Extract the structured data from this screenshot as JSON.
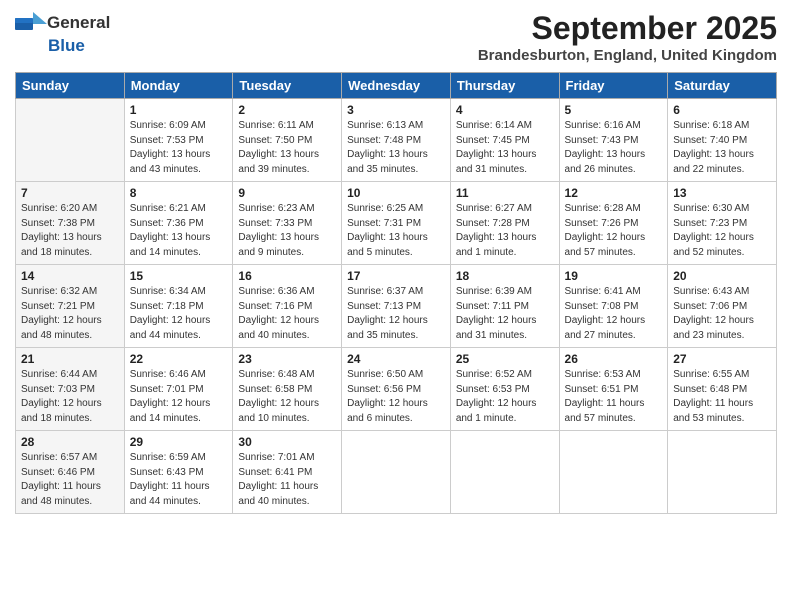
{
  "logo": {
    "general": "General",
    "blue": "Blue"
  },
  "title": "September 2025",
  "subtitle": "Brandesburton, England, United Kingdom",
  "days": [
    "Sunday",
    "Monday",
    "Tuesday",
    "Wednesday",
    "Thursday",
    "Friday",
    "Saturday"
  ],
  "weeks": [
    [
      {
        "day": "",
        "info": ""
      },
      {
        "day": "1",
        "info": "Sunrise: 6:09 AM\nSunset: 7:53 PM\nDaylight: 13 hours\nand 43 minutes."
      },
      {
        "day": "2",
        "info": "Sunrise: 6:11 AM\nSunset: 7:50 PM\nDaylight: 13 hours\nand 39 minutes."
      },
      {
        "day": "3",
        "info": "Sunrise: 6:13 AM\nSunset: 7:48 PM\nDaylight: 13 hours\nand 35 minutes."
      },
      {
        "day": "4",
        "info": "Sunrise: 6:14 AM\nSunset: 7:45 PM\nDaylight: 13 hours\nand 31 minutes."
      },
      {
        "day": "5",
        "info": "Sunrise: 6:16 AM\nSunset: 7:43 PM\nDaylight: 13 hours\nand 26 minutes."
      },
      {
        "day": "6",
        "info": "Sunrise: 6:18 AM\nSunset: 7:40 PM\nDaylight: 13 hours\nand 22 minutes."
      }
    ],
    [
      {
        "day": "7",
        "info": "Sunrise: 6:20 AM\nSunset: 7:38 PM\nDaylight: 13 hours\nand 18 minutes."
      },
      {
        "day": "8",
        "info": "Sunrise: 6:21 AM\nSunset: 7:36 PM\nDaylight: 13 hours\nand 14 minutes."
      },
      {
        "day": "9",
        "info": "Sunrise: 6:23 AM\nSunset: 7:33 PM\nDaylight: 13 hours\nand 9 minutes."
      },
      {
        "day": "10",
        "info": "Sunrise: 6:25 AM\nSunset: 7:31 PM\nDaylight: 13 hours\nand 5 minutes."
      },
      {
        "day": "11",
        "info": "Sunrise: 6:27 AM\nSunset: 7:28 PM\nDaylight: 13 hours\nand 1 minute."
      },
      {
        "day": "12",
        "info": "Sunrise: 6:28 AM\nSunset: 7:26 PM\nDaylight: 12 hours\nand 57 minutes."
      },
      {
        "day": "13",
        "info": "Sunrise: 6:30 AM\nSunset: 7:23 PM\nDaylight: 12 hours\nand 52 minutes."
      }
    ],
    [
      {
        "day": "14",
        "info": "Sunrise: 6:32 AM\nSunset: 7:21 PM\nDaylight: 12 hours\nand 48 minutes."
      },
      {
        "day": "15",
        "info": "Sunrise: 6:34 AM\nSunset: 7:18 PM\nDaylight: 12 hours\nand 44 minutes."
      },
      {
        "day": "16",
        "info": "Sunrise: 6:36 AM\nSunset: 7:16 PM\nDaylight: 12 hours\nand 40 minutes."
      },
      {
        "day": "17",
        "info": "Sunrise: 6:37 AM\nSunset: 7:13 PM\nDaylight: 12 hours\nand 35 minutes."
      },
      {
        "day": "18",
        "info": "Sunrise: 6:39 AM\nSunset: 7:11 PM\nDaylight: 12 hours\nand 31 minutes."
      },
      {
        "day": "19",
        "info": "Sunrise: 6:41 AM\nSunset: 7:08 PM\nDaylight: 12 hours\nand 27 minutes."
      },
      {
        "day": "20",
        "info": "Sunrise: 6:43 AM\nSunset: 7:06 PM\nDaylight: 12 hours\nand 23 minutes."
      }
    ],
    [
      {
        "day": "21",
        "info": "Sunrise: 6:44 AM\nSunset: 7:03 PM\nDaylight: 12 hours\nand 18 minutes."
      },
      {
        "day": "22",
        "info": "Sunrise: 6:46 AM\nSunset: 7:01 PM\nDaylight: 12 hours\nand 14 minutes."
      },
      {
        "day": "23",
        "info": "Sunrise: 6:48 AM\nSunset: 6:58 PM\nDaylight: 12 hours\nand 10 minutes."
      },
      {
        "day": "24",
        "info": "Sunrise: 6:50 AM\nSunset: 6:56 PM\nDaylight: 12 hours\nand 6 minutes."
      },
      {
        "day": "25",
        "info": "Sunrise: 6:52 AM\nSunset: 6:53 PM\nDaylight: 12 hours\nand 1 minute."
      },
      {
        "day": "26",
        "info": "Sunrise: 6:53 AM\nSunset: 6:51 PM\nDaylight: 11 hours\nand 57 minutes."
      },
      {
        "day": "27",
        "info": "Sunrise: 6:55 AM\nSunset: 6:48 PM\nDaylight: 11 hours\nand 53 minutes."
      }
    ],
    [
      {
        "day": "28",
        "info": "Sunrise: 6:57 AM\nSunset: 6:46 PM\nDaylight: 11 hours\nand 48 minutes."
      },
      {
        "day": "29",
        "info": "Sunrise: 6:59 AM\nSunset: 6:43 PM\nDaylight: 11 hours\nand 44 minutes."
      },
      {
        "day": "30",
        "info": "Sunrise: 7:01 AM\nSunset: 6:41 PM\nDaylight: 11 hours\nand 40 minutes."
      },
      {
        "day": "",
        "info": ""
      },
      {
        "day": "",
        "info": ""
      },
      {
        "day": "",
        "info": ""
      },
      {
        "day": "",
        "info": ""
      }
    ]
  ]
}
